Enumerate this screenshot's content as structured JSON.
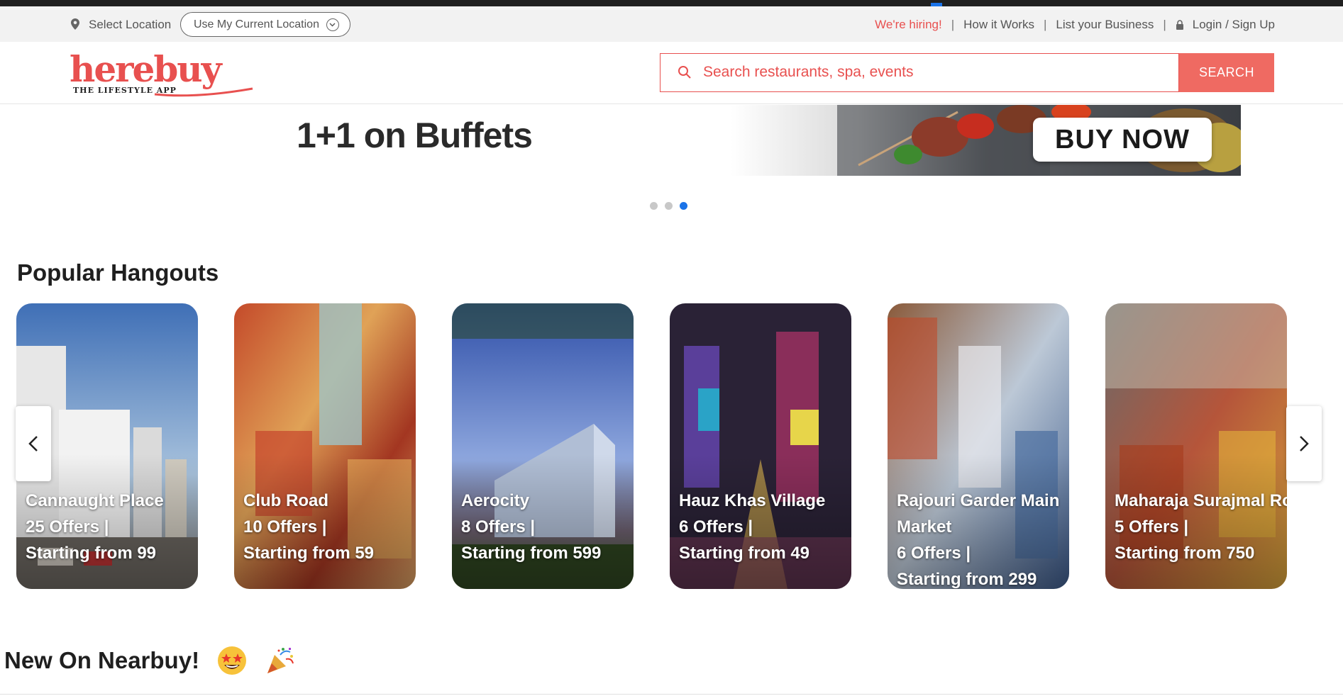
{
  "topbar": {
    "select_location": "Select Location",
    "use_location": "Use My Current Location",
    "links": {
      "hiring": "We're hiring!",
      "how": "How it Works",
      "list": "List your Business",
      "login": "Login / Sign Up"
    },
    "separator": "|"
  },
  "header": {
    "logo_word": "herebuy",
    "logo_tagline": "THE LIFESTYLE APP",
    "search_placeholder": "Search restaurants, spa, events",
    "search_button": "SEARCH"
  },
  "banner": {
    "headline": "1+1 on Buffets",
    "cta": "BUY NOW"
  },
  "carousel": {
    "dot_count": 3,
    "active_index": 2
  },
  "popular": {
    "title": "Popular Hangouts",
    "cards": [
      {
        "name": "Cannaught Place",
        "offers": "25 Offers |",
        "starting": "Starting from 99"
      },
      {
        "name": "Club Road",
        "offers": "10 Offers |",
        "starting": "Starting from 59"
      },
      {
        "name": "Aerocity",
        "offers": "8 Offers |",
        "starting": "Starting from 599"
      },
      {
        "name": "Hauz Khas Village",
        "offers": "6 Offers |",
        "starting": "Starting from 49"
      },
      {
        "name": "Rajouri Garder Main Market",
        "offers": "6 Offers |",
        "starting": "Starting from 299"
      },
      {
        "name": "Maharaja Surajmal Road",
        "offers": "5 Offers |",
        "starting": "Starting from 750"
      }
    ]
  },
  "new_section": {
    "title": "New On Nearbuy!"
  },
  "colors": {
    "brand": "#e8504f",
    "search_button": "#ef6a62",
    "active_dot": "#1a73e8"
  },
  "icons": [
    "location-pin-icon",
    "chevron-down-icon",
    "lock-icon",
    "search-icon",
    "chevron-left-icon",
    "chevron-right-icon",
    "star-struck-emoji-icon",
    "party-popper-emoji-icon"
  ]
}
